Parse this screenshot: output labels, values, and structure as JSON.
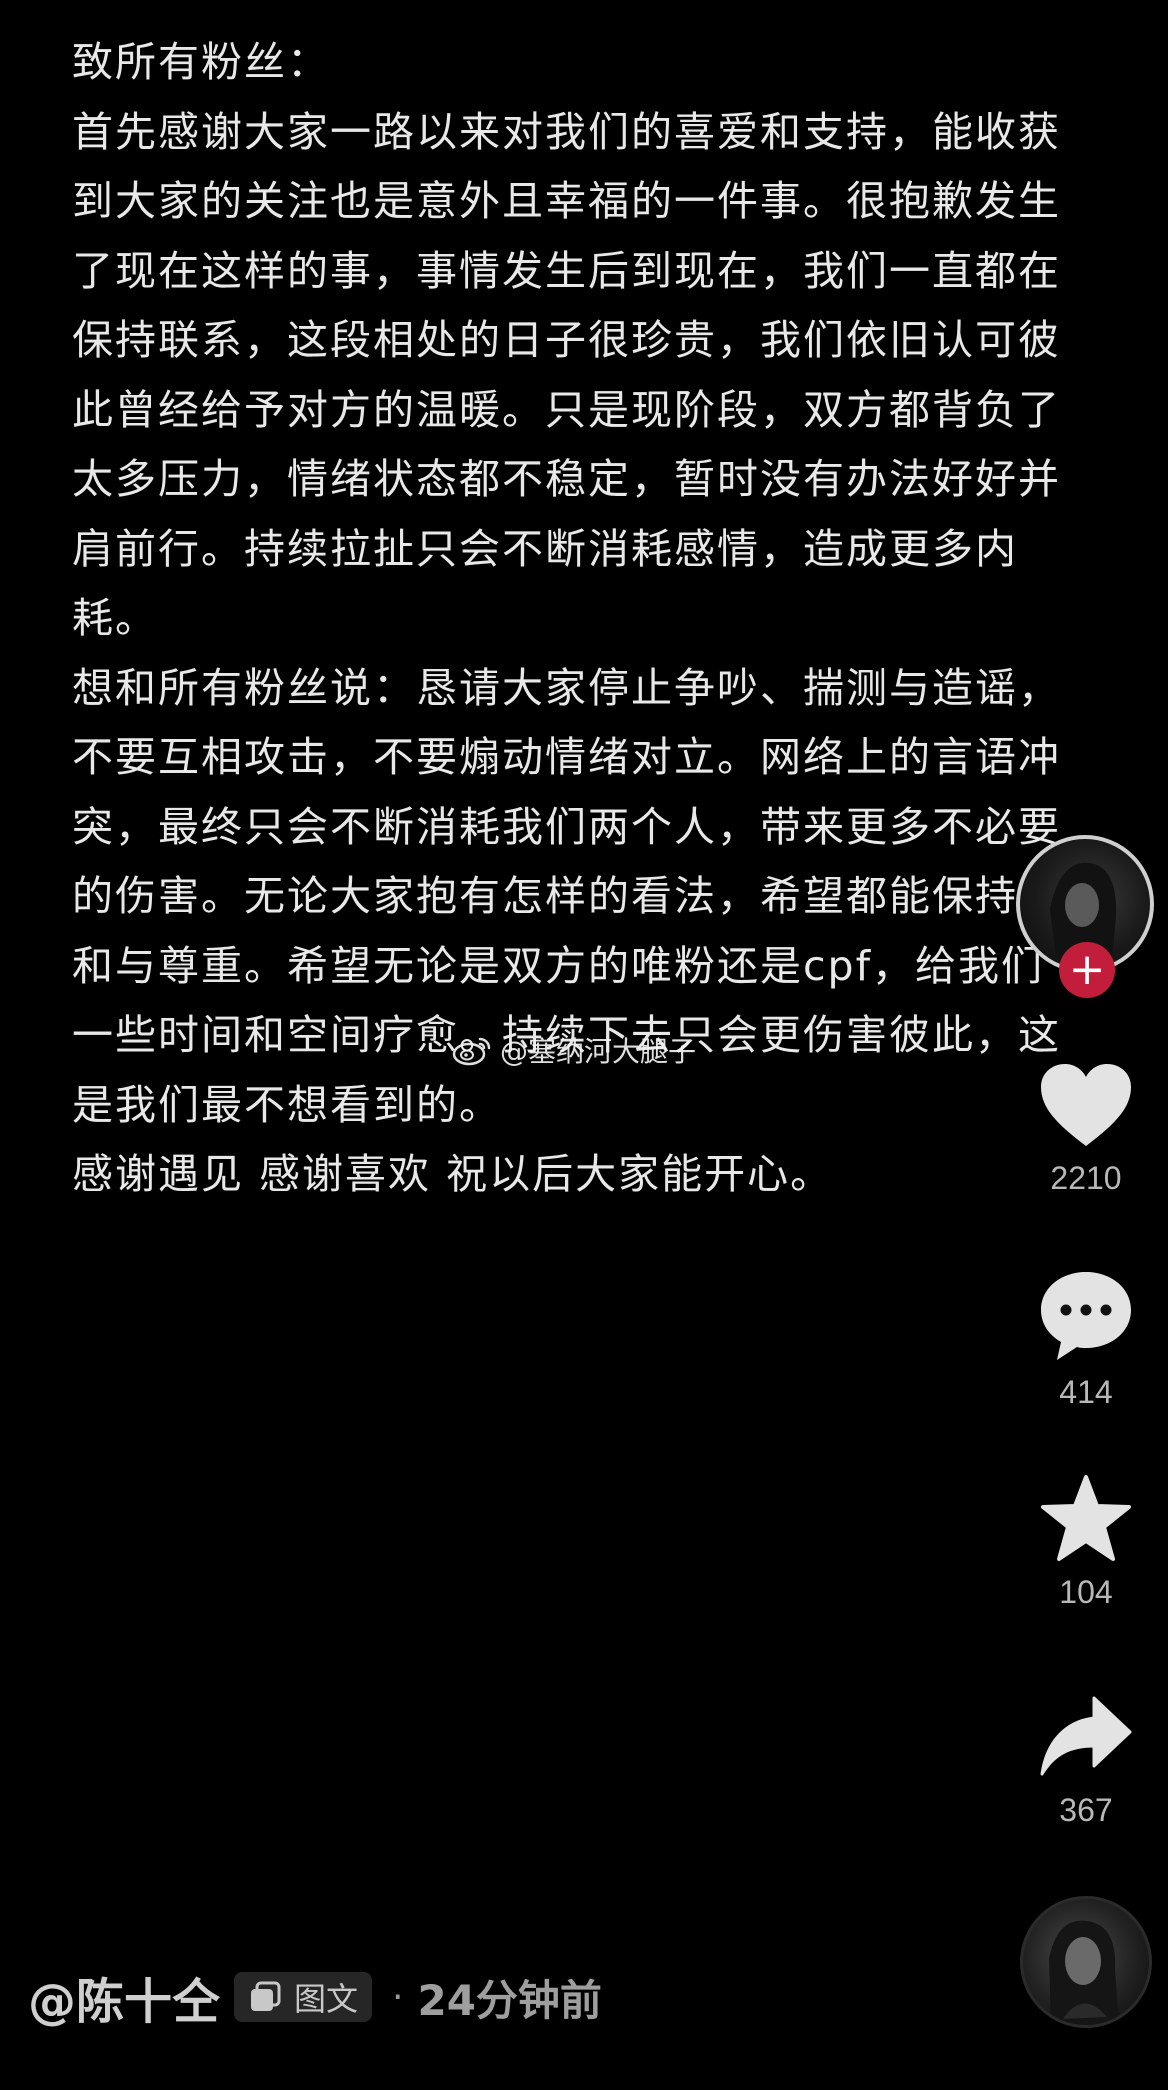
{
  "post": {
    "paragraphs": [
      "致所有粉丝：",
      "首先感谢大家一路以来对我们的喜爱和支持，能收获到大家的关注也是意外且幸福的一件事。很抱歉发生了现在这样的事，事情发生后到现在，我们一直都在保持联系，这段相处的日子很珍贵，我们依旧认可彼此曾经给予对方的温暖。只是现阶段，双方都背负了太多压力，情绪状态都不稳定，暂时没有办法好好并肩前行。持续拉扯只会不断消耗感情，造成更多内耗。",
      "想和所有粉丝说：恳请大家停止争吵、揣测与造谣，不要互相攻击，不要煽动情绪对立。网络上的言语冲突，最终只会不断消耗我们两个人，带来更多不必要的伤害。无论大家抱有怎样的看法，希望都能保持平和与尊重。希望无论是双方的唯粉还是cpf，给我们一些时间和空间疗愈。持续下去只会更伤害彼此，这是我们最不想看到的。",
      "感谢遇见 感谢喜欢 祝以后大家能开心。"
    ]
  },
  "watermark": {
    "text": "@塞纳河大腿子"
  },
  "actions": {
    "like_count": "2210",
    "comment_count": "414",
    "favorite_count": "104",
    "share_count": "367"
  },
  "footer": {
    "author": "@陈十仝",
    "type_label": "图文",
    "separator": "·",
    "time": "24分钟前"
  },
  "colors": {
    "background": "#000000",
    "follow_accent": "#c21d3a",
    "icon": "#e3e3e3"
  }
}
